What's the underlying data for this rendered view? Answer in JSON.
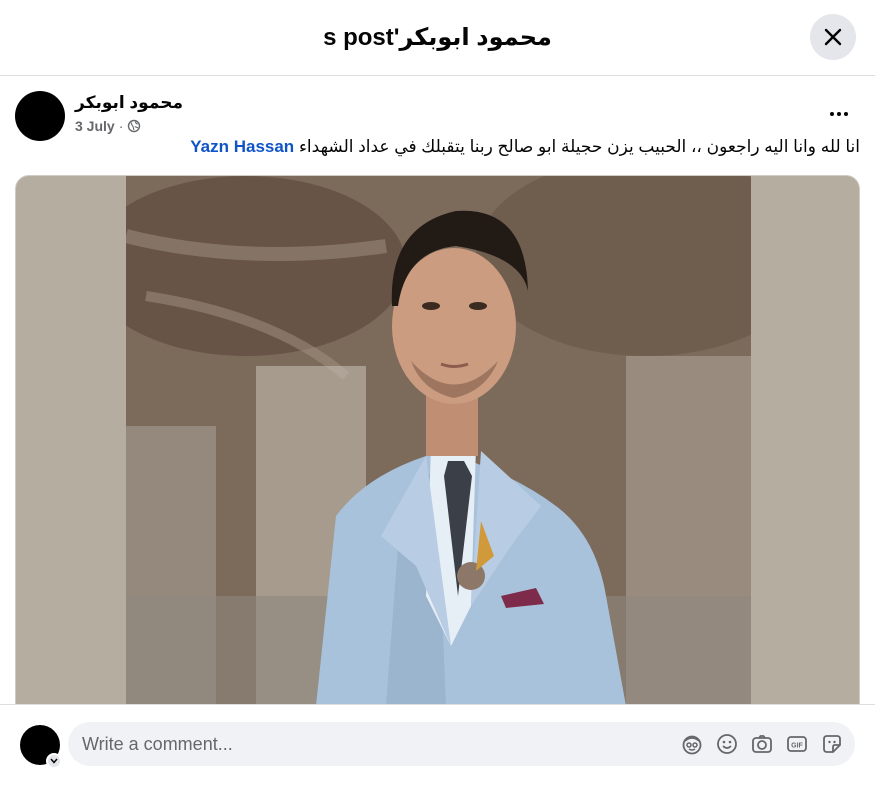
{
  "dialog": {
    "title": "محمود ابوبكر's post"
  },
  "post": {
    "author": "محمود ابوبكر",
    "date": "3 July",
    "separator": "·",
    "audience_icon": "globe-icon",
    "text_before_mention": "انا لله وانا اليه راجعون ،، الحبيب يزن حجيلة ابو صالح ربنا يتقبلك في عداد الشهداء",
    "mention": "Yazn Hassan"
  },
  "comment": {
    "placeholder": "Write a comment...",
    "tools": [
      "avatar-sticker-icon",
      "emoji-icon",
      "camera-icon",
      "gif-icon",
      "sticker-icon"
    ]
  },
  "colors": {
    "mention": "#1055c8",
    "secondary_text": "#65676b",
    "input_bg": "#f0f2f5",
    "button_bg": "#e4e6eb",
    "photo_sides": "#b5ad9f"
  }
}
